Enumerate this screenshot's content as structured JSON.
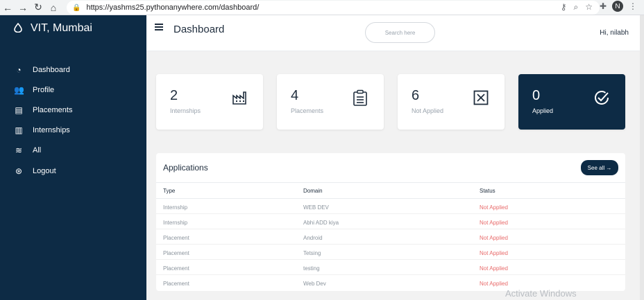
{
  "browser": {
    "url": "https://yashms25.pythonanywhere.com/dashboard/",
    "profile_initial": "N"
  },
  "sidebar": {
    "brand": "VIT, Mumbai",
    "items": [
      {
        "label": "Dashboard",
        "icon": "dashboard-icon"
      },
      {
        "label": "Profile",
        "icon": "users-icon"
      },
      {
        "label": "Placements",
        "icon": "clipboard-icon"
      },
      {
        "label": "Internships",
        "icon": "chart-icon"
      },
      {
        "label": "All",
        "icon": "database-icon"
      },
      {
        "label": "Logout",
        "icon": "logout-icon"
      }
    ]
  },
  "topbar": {
    "title": "Dashboard",
    "search_placeholder": "Search here",
    "greeting": "Hi, nilabh"
  },
  "cards": [
    {
      "value": "2",
      "label": "Internships",
      "icon": "industry-chart-icon"
    },
    {
      "value": "4",
      "label": "Placements",
      "icon": "clipboard-list-icon"
    },
    {
      "value": "6",
      "label": "Not Applied",
      "icon": "x-box-icon"
    },
    {
      "value": "0",
      "label": "Applied",
      "icon": "check-circle-icon"
    }
  ],
  "applications": {
    "title": "Applications",
    "see_all_label": "See all →",
    "columns": [
      "Type",
      "Domain",
      "Status"
    ],
    "rows": [
      {
        "type": "Internship",
        "domain": "WEB DEV",
        "status": "Not Applied"
      },
      {
        "type": "Internship",
        "domain": "Abhi ADD kiya",
        "status": "Not Applied"
      },
      {
        "type": "Placement",
        "domain": "Android",
        "status": "Not Applied"
      },
      {
        "type": "Placement",
        "domain": "Tetsing",
        "status": "Not Applied"
      },
      {
        "type": "Placement",
        "domain": "testing",
        "status": "Not Applied"
      },
      {
        "type": "Placement",
        "domain": "Web Dev",
        "status": "Not Applied"
      }
    ]
  },
  "watermark": "Activate Windows",
  "colors": {
    "navy": "#0d2b45",
    "status_red": "#e86a6a",
    "background": "#f2f2f2"
  }
}
